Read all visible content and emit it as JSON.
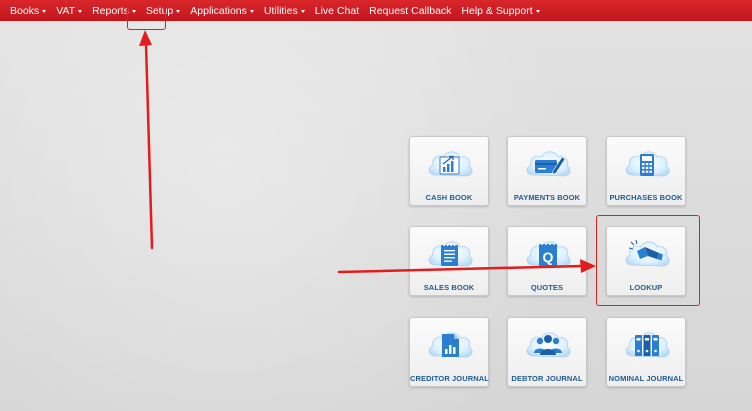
{
  "nav": {
    "items": [
      {
        "label": "Books",
        "has_dropdown": true
      },
      {
        "label": "VAT",
        "has_dropdown": true
      },
      {
        "label": "Reports",
        "has_dropdown": true
      },
      {
        "label": "Setup",
        "has_dropdown": true
      },
      {
        "label": "Applications",
        "has_dropdown": true
      },
      {
        "label": "Utilities",
        "has_dropdown": true
      },
      {
        "label": "Live Chat",
        "has_dropdown": false
      },
      {
        "label": "Request Callback",
        "has_dropdown": false
      },
      {
        "label": "Help & Support",
        "has_dropdown": true
      }
    ]
  },
  "tiles": [
    {
      "label": "CASH BOOK",
      "icon": "chart-growth-icon"
    },
    {
      "label": "PAYMENTS BOOK",
      "icon": "card-pen-icon"
    },
    {
      "label": "PURCHASES BOOK",
      "icon": "calculator-icon"
    },
    {
      "label": "SALES BOOK",
      "icon": "notepad-icon"
    },
    {
      "label": "QUOTES",
      "icon": "quote-document-icon"
    },
    {
      "label": "LOOKUP",
      "icon": "flashlight-icon"
    },
    {
      "label": "CREDITOR JOURNAL",
      "icon": "document-chart-icon"
    },
    {
      "label": "DEBTOR JOURNAL",
      "icon": "people-group-icon"
    },
    {
      "label": "NOMINAL JOURNAL",
      "icon": "binders-icon"
    }
  ],
  "colors": {
    "navbar": "#cc1d23",
    "tile_label": "#1e5c96",
    "icon_blue": "#2a7fd0",
    "cloud": "#d8ecfb",
    "annotation": "#e02020"
  }
}
